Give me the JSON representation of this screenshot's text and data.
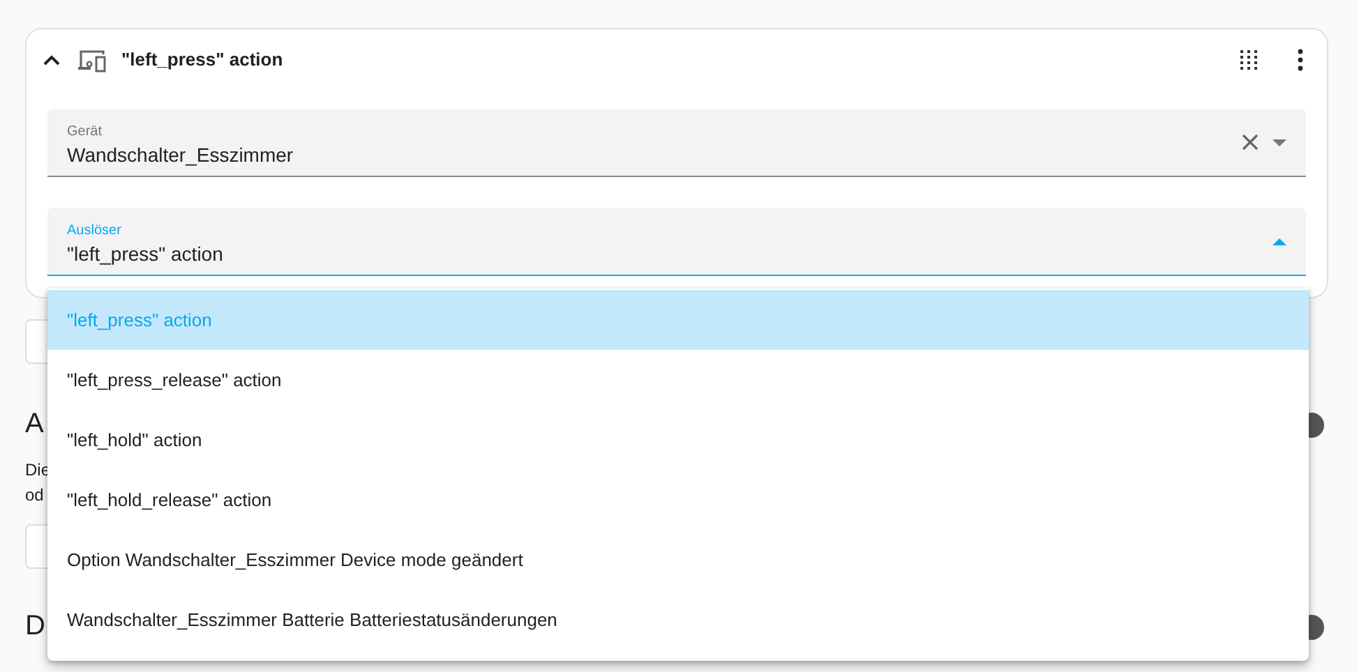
{
  "card": {
    "title": "\"left_press\" action",
    "expanded": true
  },
  "fields": [
    {
      "label": "Gerät",
      "value": "Wandschalter_Esszimmer",
      "focused": false,
      "clearable": true
    },
    {
      "label": "Auslöser",
      "value": "\"left_press\" action",
      "focused": true,
      "clearable": false
    }
  ],
  "menu": {
    "items": [
      {
        "label": "\"left_press\" action",
        "selected": true
      },
      {
        "label": "\"left_press_release\" action",
        "selected": false
      },
      {
        "label": "\"left_hold\" action",
        "selected": false
      },
      {
        "label": "\"left_hold_release\" action",
        "selected": false
      },
      {
        "label": "Option Wandschalter_Esszimmer Device mode geändert",
        "selected": false
      },
      {
        "label": "Wandschalter_Esszimmer Batterie Batteriestatusänderungen",
        "selected": false
      }
    ]
  },
  "background": {
    "sections": [
      {
        "heading": "A",
        "paragraph_lines": [
          "Die",
          "od"
        ],
        "has_button": true
      },
      {
        "heading": "D"
      }
    ]
  }
}
